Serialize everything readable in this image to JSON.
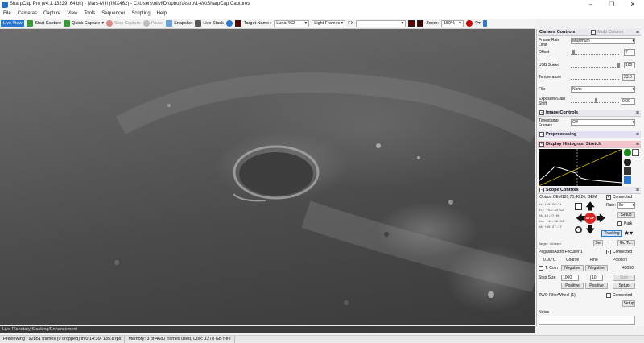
{
  "window": {
    "title": "SharpCap Pro (v4.1.13229, 64 bit) - Mars-M II (IMX462) - C:\\Users\\olivi\\Dropbox\\Astro\\1-VA\\SharpCap Captures"
  },
  "menu": [
    "File",
    "Cameras",
    "Capture",
    "View",
    "Tools",
    "Sequencer",
    "Scripting",
    "Help"
  ],
  "toolbar": {
    "live_view": "Live View",
    "start_capture": "Start Capture",
    "quick_capture": "Quick Capture",
    "stop_capture": "Stop Capture",
    "pause": "Pause",
    "snapshot": "Snapshot",
    "live_stack": "Live Stack",
    "target_name_label": "Target Name :",
    "target_name_value": "Luna 462",
    "frame_type": "Light Frames",
    "fx_label": "FX",
    "zoom_label": "Zoom:",
    "zoom_value": "150%"
  },
  "status": {
    "banner": "Live Planetary Stacking/Enhancement",
    "previewing": "Previewing : 92851 frames (9 dropped) in 0:14:39, 135.8 fps",
    "memory": "Memory: 3 of 4680 frames used, Disk: 1278 GB free"
  },
  "panel": {
    "camera_controls": {
      "title": "Camera Controls",
      "multi_column": "Multi Column",
      "frame_rate_label": "Frame Rate Limit",
      "frame_rate_value": "Maximum",
      "offset_label": "Offset",
      "offset_value": "7",
      "usb_label": "USB Speed",
      "usb_value": "100",
      "temp_label": "Temperature",
      "temp_value": "23.0",
      "flip_label": "Flip",
      "flip_value": "None",
      "exposure_label": "Exposure/Gain Shift",
      "exposure_value": "0.00"
    },
    "image_controls": {
      "title": "Image Controls",
      "timestamp_label": "Timestamp Frames",
      "timestamp_value": "Off"
    },
    "preprocessing": {
      "title": "Preprocessing"
    },
    "histogram": {
      "title": "Display Histogram Stretch"
    },
    "scope": {
      "title": "Scope Controls",
      "mount": "iOptron CEM120,70,40,26, GEM",
      "connected": "Connected",
      "rate_label": "Rate:",
      "rate_value": "8x",
      "setup": "Setup",
      "park": "Park",
      "tracking": "Tracking",
      "goto": "Go To..",
      "set": "Set",
      "stop": "STOP",
      "coords": [
        {
          "k": "Az",
          "v": "150:59:21"
        },
        {
          "k": "Alt",
          "v": "+52:33:52"
        },
        {
          "k": "RA",
          "v": "10:27:06"
        },
        {
          "k": "Dec",
          "v": "+11:36:34"
        },
        {
          "k": "HA",
          "v": "+00:27:17"
        }
      ],
      "target_label": "Target: <Unset>"
    },
    "focuser": {
      "name": "PegasusAstro Focuser 1",
      "connected": "Connected",
      "temp": "0.00°C",
      "coarse": "Coarse",
      "fine": "Fine",
      "position_label": "Position",
      "position": "48030",
      "tcomp": "T. Com",
      "negative": "Negative",
      "stop": "Stop",
      "stepsize_label": "Step Size",
      "stepsize": "1000",
      "fine_value": "10",
      "positive": "Positive",
      "setup": "Setup"
    },
    "filterwheel": {
      "name": "ZWO FilterWheel (1)",
      "connected": "Connected",
      "setup": "Setup"
    },
    "notes": {
      "label": "Notes"
    }
  }
}
